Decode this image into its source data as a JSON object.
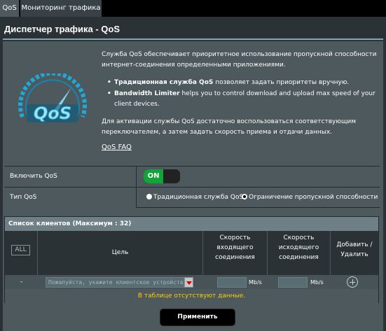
{
  "tabs": [
    {
      "label": "QoS"
    },
    {
      "label": "Мониторинг трафика"
    }
  ],
  "page_title": "Диспетчер трафика - QoS",
  "logo_text": "QoS",
  "description": {
    "intro": "Служба QoS обеспечивает приоритетное использование пропускной способности интернет-соединения определенными приложениями.",
    "bullet1_strong": "Традиционная служба QoS",
    "bullet1_rest": " позволяет задать приоритеты вручную.",
    "bullet2_strong": "Bandwidth Limiter",
    "bullet2_rest": " helps you to control download and upload max speed of your client devices.",
    "outro": "Для активации службы QoS достаточно воспользоваться соответствующим переключателем, а затем задать скорость приема и отдачи данных.",
    "faq_link": "QoS FAQ"
  },
  "settings": {
    "enable_label": "Включить QoS",
    "enable_state": "ON",
    "type_label": "Тип QoS",
    "type_options": [
      "Традиционная служба QoS",
      "Ограничение пропускной способности"
    ],
    "type_selected": 1
  },
  "clients": {
    "title": "Список клиентов (Максимум : 32)",
    "all_button": "ALL",
    "columns": {
      "target": "Цель",
      "download": "Скорость входящего соединения",
      "upload": "Скорость исходящего соединения",
      "add_delete": "Добавить / Удалить"
    },
    "row": {
      "dash": "-",
      "target_placeholder": "Пожалуйста, укажите клиентское устройство",
      "unit_down": "Mb/s",
      "unit_up": "Mb/s"
    },
    "no_data": "В таблице отсутствуют данные."
  },
  "apply_button": "Применить",
  "colors": {
    "background": "#2b3235",
    "panel": "#4d595d",
    "toggle_on": "#13a437",
    "no_data_text": "#ffcc00"
  }
}
